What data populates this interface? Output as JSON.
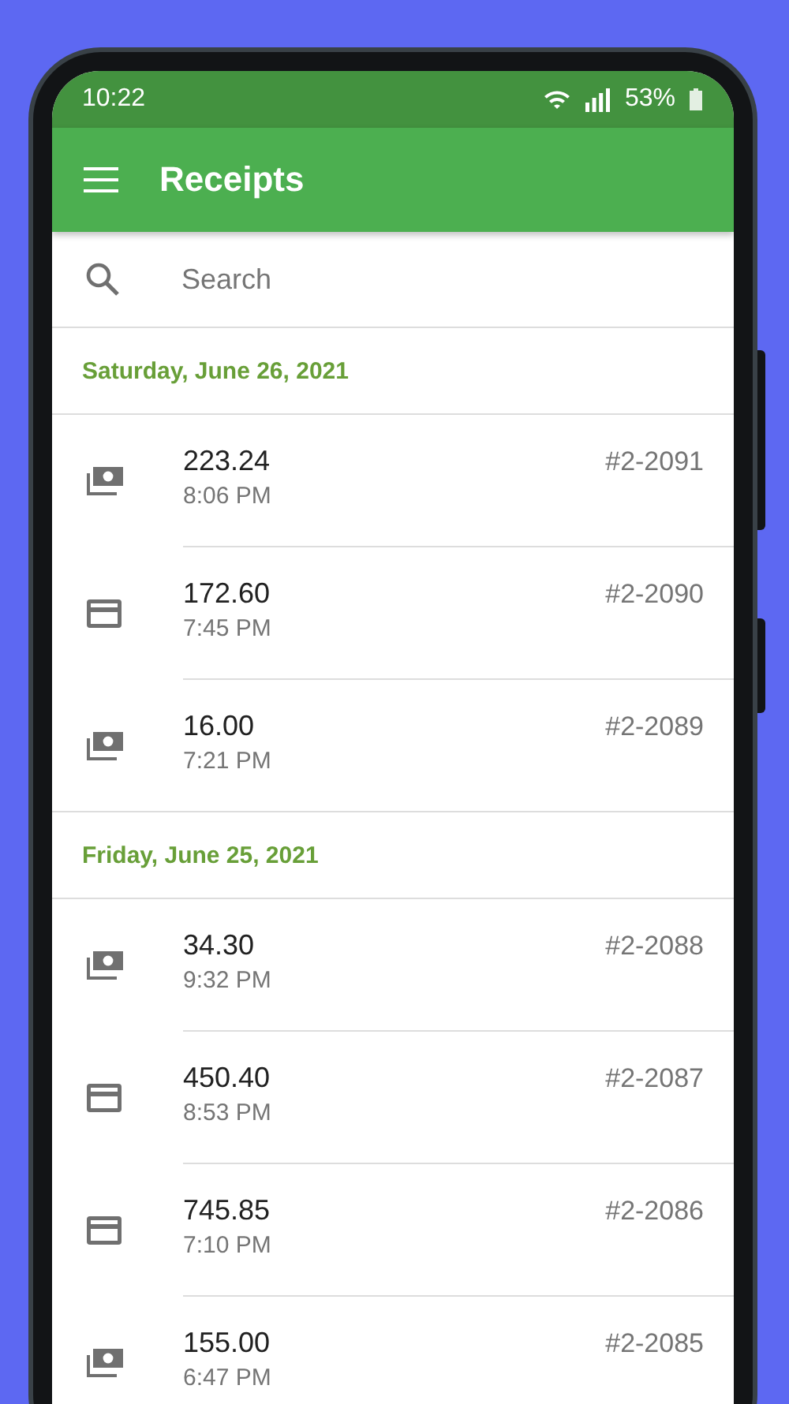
{
  "status_bar": {
    "time": "10:22",
    "battery": "53%"
  },
  "app_bar": {
    "title": "Receipts"
  },
  "search": {
    "placeholder": "Search"
  },
  "sections": [
    {
      "date": "Saturday, June 26, 2021",
      "receipts": [
        {
          "kind": "cash",
          "amount": "223.24",
          "time": "8:06 PM",
          "number": "#2-2091"
        },
        {
          "kind": "card",
          "amount": "172.60",
          "time": "7:45 PM",
          "number": "#2-2090"
        },
        {
          "kind": "cash",
          "amount": "16.00",
          "time": "7:21 PM",
          "number": "#2-2089"
        }
      ]
    },
    {
      "date": "Friday, June 25, 2021",
      "receipts": [
        {
          "kind": "cash",
          "amount": "34.30",
          "time": "9:32 PM",
          "number": "#2-2088"
        },
        {
          "kind": "card",
          "amount": "450.40",
          "time": "8:53 PM",
          "number": "#2-2087"
        },
        {
          "kind": "card",
          "amount": "745.85",
          "time": "7:10 PM",
          "number": "#2-2086"
        },
        {
          "kind": "cash",
          "amount": "155.00",
          "time": "6:47 PM",
          "number": "#2-2085"
        }
      ]
    }
  ]
}
